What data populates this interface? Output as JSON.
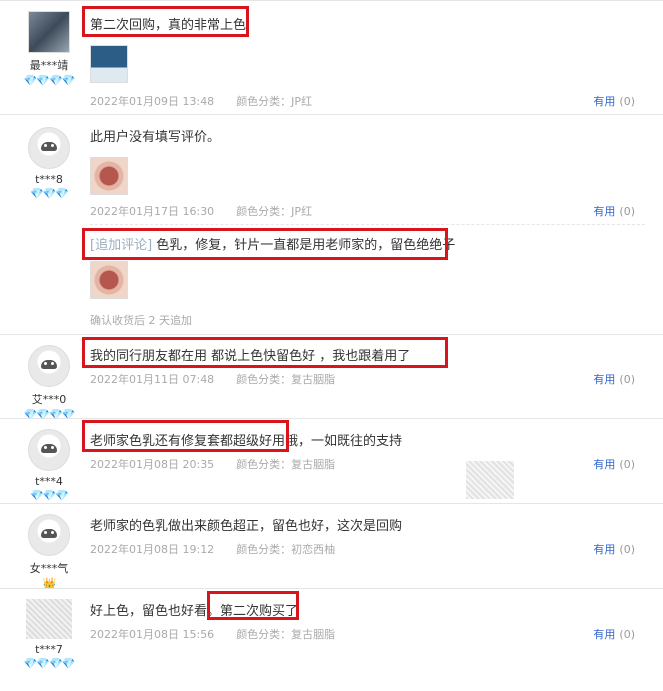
{
  "reviews": [
    {
      "user": "最***靖",
      "badge": "💎💎💎💎",
      "text": "第二次回购，真的非常上色",
      "date": "2022年01月09日 13:48",
      "category": "颜色分类：JP红",
      "useful_label": "有用",
      "useful_count": "(0)"
    },
    {
      "user": "t***8",
      "badge": "💎💎💎",
      "text": "此用户没有填写评价。",
      "date": "2022年01月17日 16:30",
      "category": "颜色分类：JP红",
      "useful_label": "有用",
      "useful_count": "(0)",
      "append_tag": "[追加评论]",
      "append_text": " 色乳，修复，针片一直都是用老师家的，留色绝绝子",
      "append_confirm": "确认收货后 2 天追加"
    },
    {
      "user": "艾***0",
      "badge": "💎💎💎💎",
      "text": "我的同行朋友都在用 都说上色快留色好 ，我也跟着用了",
      "date": "2022年01月11日 07:48",
      "category": "颜色分类：复古胭脂",
      "useful_label": "有用",
      "useful_count": "(0)"
    },
    {
      "user": "t***4",
      "badge": "💎💎💎",
      "text": "老师家色乳还有修复套都超级好用哦，一如既往的支持",
      "date": "2022年01月08日 20:35",
      "category": "颜色分类：复古胭脂",
      "useful_label": "有用",
      "useful_count": "(0)"
    },
    {
      "user": "女***气",
      "badge": "👑",
      "text": "老师家的色乳做出来颜色超正，留色也好，这次是回购",
      "date": "2022年01月08日 19:12",
      "category": "颜色分类：初恋西柚",
      "useful_label": "有用",
      "useful_count": "(0)"
    },
    {
      "user": "t***7",
      "badge": "💎💎💎💎",
      "text": "好上色，留色也好看。第二次购买了",
      "date": "2022年01月08日 15:56",
      "category": "颜色分类：复古胭脂",
      "useful_label": "有用",
      "useful_count": "(0)"
    }
  ],
  "colors": {
    "highlight": "#d8141c",
    "link": "#3366cc",
    "badge": "#3aa0e6"
  }
}
